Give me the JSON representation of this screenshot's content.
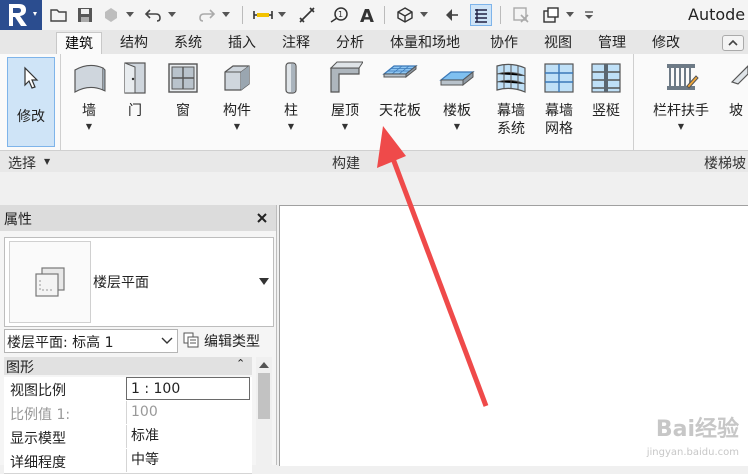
{
  "window": {
    "title_partial": "Autode"
  },
  "tabs": [
    {
      "label": "建筑",
      "active": true
    },
    {
      "label": "结构"
    },
    {
      "label": "系统"
    },
    {
      "label": "插入"
    },
    {
      "label": "注释"
    },
    {
      "label": "分析"
    },
    {
      "label": "体量和场地"
    },
    {
      "label": "协作"
    },
    {
      "label": "视图"
    },
    {
      "label": "管理"
    },
    {
      "label": "修改"
    }
  ],
  "ribbon": {
    "modify": "修改",
    "wall": "墙",
    "door": "门",
    "window": "窗",
    "component": "构件",
    "column": "柱",
    "roof": "屋顶",
    "ceiling": "天花板",
    "floor": "楼板",
    "curtain_system_1": "幕墙",
    "curtain_system_2": "系统",
    "curtain_grid_1": "幕墙",
    "curtain_grid_2": "网格",
    "mullion": "竖梃",
    "railing": "栏杆扶手",
    "ramp_partial": "坡",
    "panel_select": "选择",
    "panel_build": "构建",
    "panel_stairs_partial": "楼梯坡"
  },
  "properties": {
    "title": "属性",
    "type_name": "楼层平面",
    "instance_selector": "楼层平面: 标高 1",
    "edit_type": "编辑类型",
    "group": "图形",
    "rows": [
      {
        "key": "视图比例",
        "value": "1 : 100"
      },
      {
        "key": "比例值 1:",
        "value": "100"
      },
      {
        "key": "显示模型",
        "value": "标准"
      },
      {
        "key": "详细程度",
        "value": "中等"
      }
    ]
  },
  "watermark": {
    "main": "Bai经验",
    "sub": "jingyan.baidu.com"
  },
  "colors": {
    "accent": "#2b4d8f",
    "arrow": "#ef4a4a",
    "selection": "#cfe4f7"
  }
}
